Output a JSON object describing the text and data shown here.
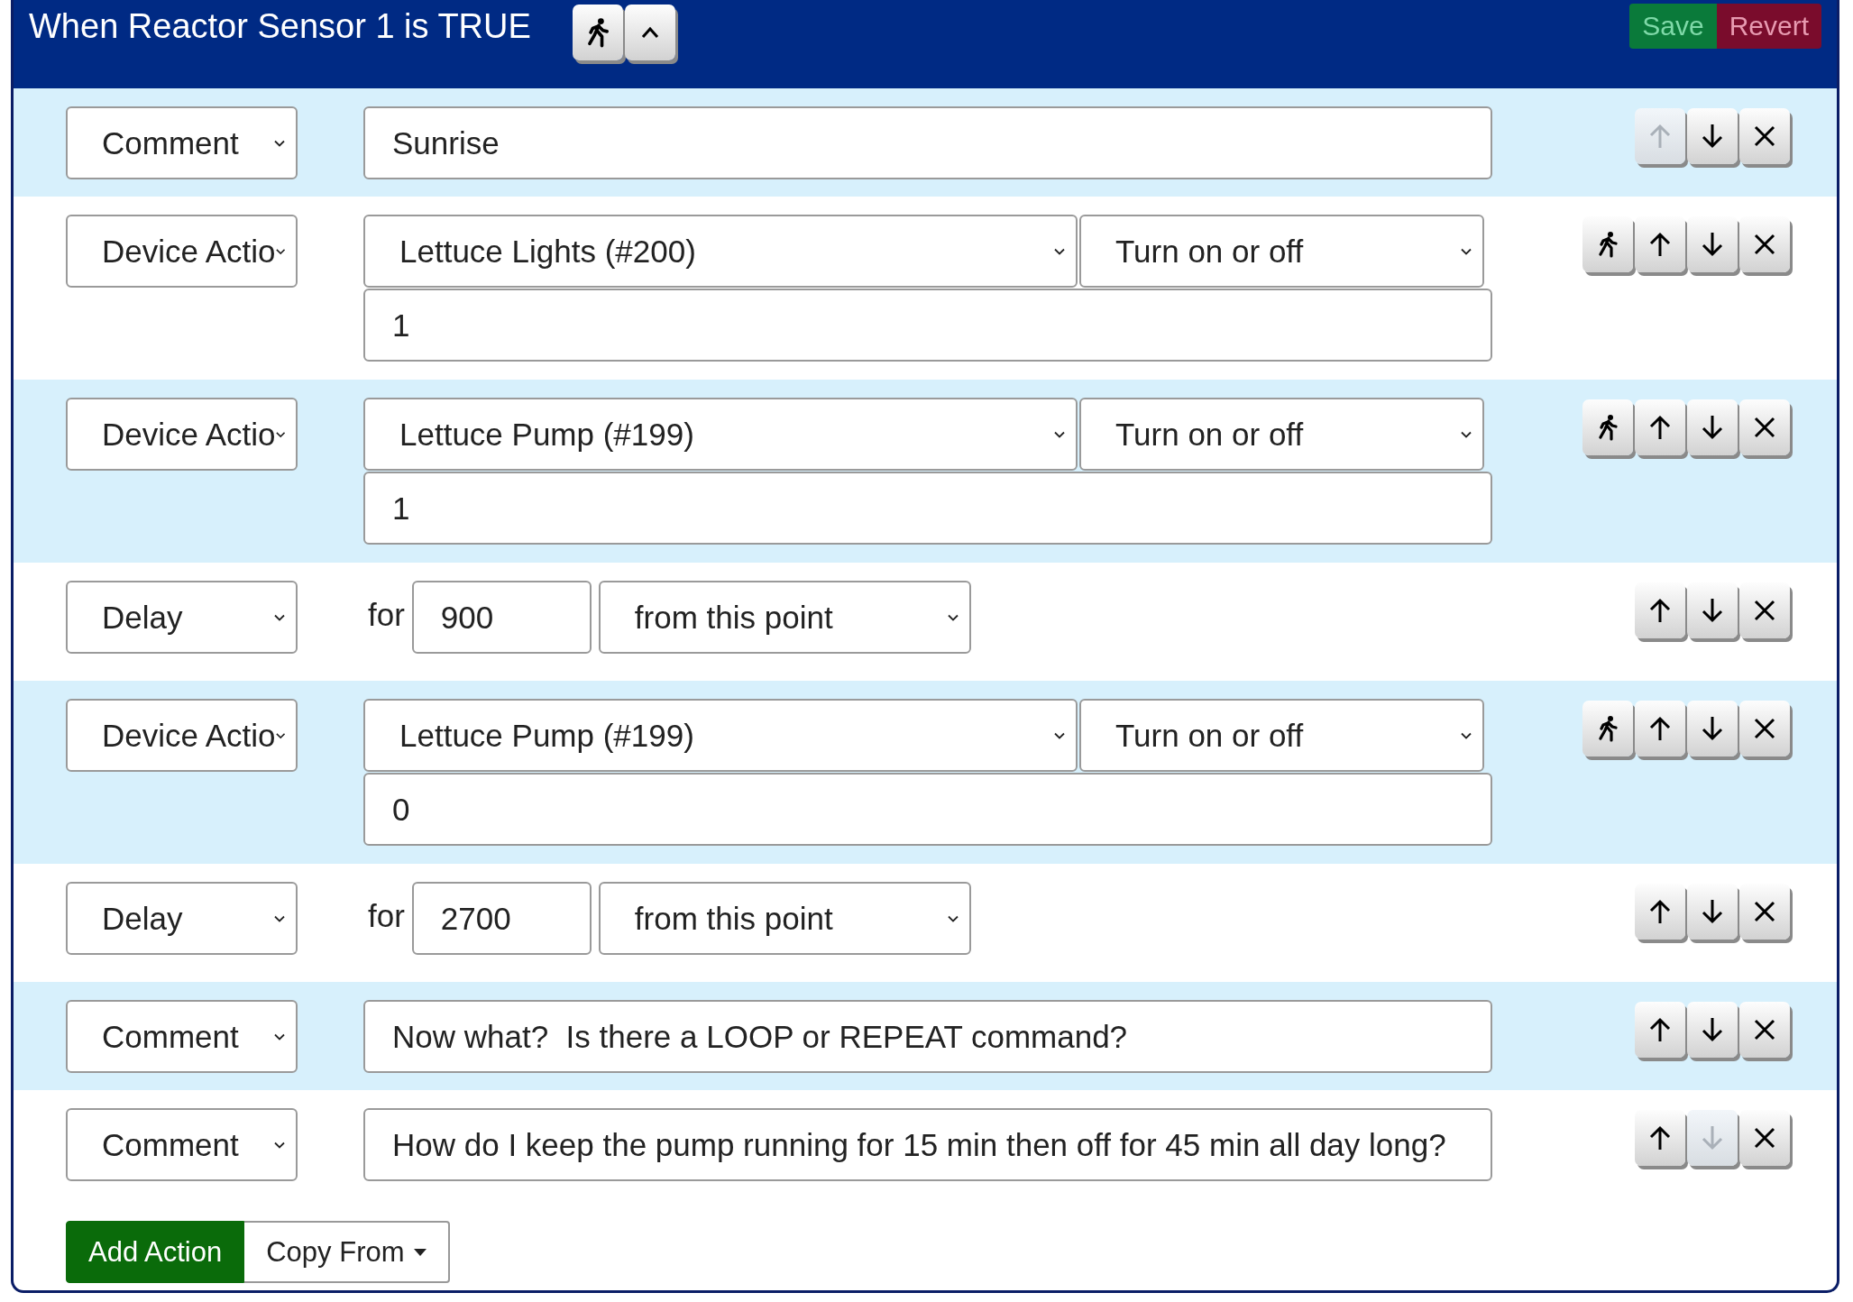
{
  "header": {
    "title": "When Reactor Sensor 1 is TRUE",
    "save_label": "Save",
    "revert_label": "Revert"
  },
  "actions": [
    {
      "kind": "comment",
      "type_label": "Comment",
      "text": "Sunrise",
      "up_disabled": true,
      "down_disabled": false
    },
    {
      "kind": "device",
      "type_label": "Device Actio",
      "device": "Lettuce Lights (#200)",
      "operation": "Turn on or off",
      "value": "1",
      "up_disabled": false,
      "down_disabled": false
    },
    {
      "kind": "device",
      "type_label": "Device Actio",
      "device": "Lettuce Pump (#199)",
      "operation": "Turn on or off",
      "value": "1",
      "up_disabled": false,
      "down_disabled": false
    },
    {
      "kind": "delay",
      "type_label": "Delay",
      "for_label": "for",
      "amount": "900",
      "mode": "from this point",
      "up_disabled": false,
      "down_disabled": false
    },
    {
      "kind": "device",
      "type_label": "Device Actio",
      "device": "Lettuce Pump (#199)",
      "operation": "Turn on or off",
      "value": "0",
      "up_disabled": false,
      "down_disabled": false
    },
    {
      "kind": "delay",
      "type_label": "Delay",
      "for_label": "for",
      "amount": "2700",
      "mode": "from this point",
      "up_disabled": false,
      "down_disabled": false
    },
    {
      "kind": "comment",
      "type_label": "Comment",
      "text": "Now what?  Is there a LOOP or REPEAT command?",
      "up_disabled": false,
      "down_disabled": false
    },
    {
      "kind": "comment",
      "type_label": "Comment",
      "text": "How do I keep the pump running for 15 min then off for 45 min all day long?",
      "up_disabled": false,
      "down_disabled": true
    }
  ],
  "footer": {
    "add_label": "Add Action",
    "copy_label": "Copy From"
  }
}
